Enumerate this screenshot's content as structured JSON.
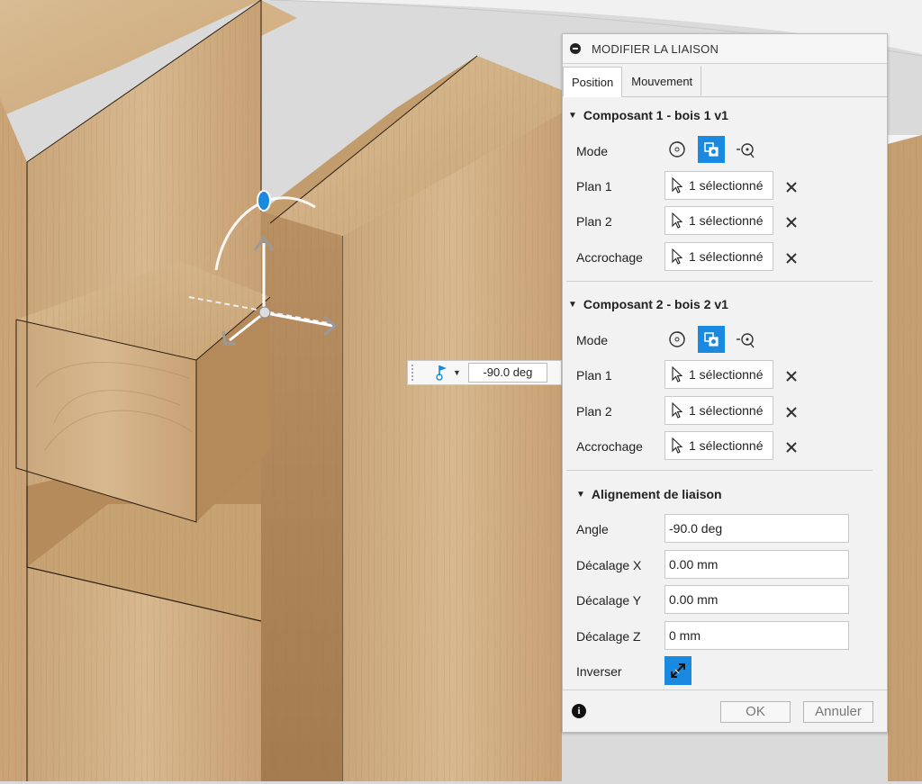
{
  "colors": {
    "accent": "#1a8ae0",
    "wood_light": "#d8b98f",
    "wood_mid": "#c9a579",
    "wood_dark": "#b38a5a"
  },
  "floating_input": {
    "value": "-90.0 deg",
    "icon": "flag-icon"
  },
  "dialog": {
    "title": "MODIFIER LA LIAISON",
    "tabs": [
      {
        "label": "Position"
      },
      {
        "label": "Mouvement"
      }
    ],
    "component1": {
      "title": "Composant 1 - bois 1 v1",
      "mode_label": "Mode",
      "rows": [
        {
          "label": "Plan 1",
          "value": "1 sélectionné"
        },
        {
          "label": "Plan 2",
          "value": "1 sélectionné"
        },
        {
          "label": "Accrochage",
          "value": "1 sélectionné"
        }
      ]
    },
    "component2": {
      "title": "Composant 2 - bois 2 v1",
      "mode_label": "Mode",
      "rows": [
        {
          "label": "Plan 1",
          "value": "1 sélectionné"
        },
        {
          "label": "Plan 2",
          "value": "1 sélectionné"
        },
        {
          "label": "Accrochage",
          "value": "1 sélectionné"
        }
      ]
    },
    "alignment": {
      "title": "Alignement de liaison",
      "angle_label": "Angle",
      "angle": "-90.0 deg",
      "offset_x_label": "Décalage X",
      "offset_x": "0.00 mm",
      "offset_y_label": "Décalage Y",
      "offset_y": "0.00 mm",
      "offset_z_label": "Décalage Z",
      "offset_z": "0 mm",
      "flip_label": "Inverser"
    },
    "ok_label": "OK",
    "cancel_label": "Annuler"
  }
}
